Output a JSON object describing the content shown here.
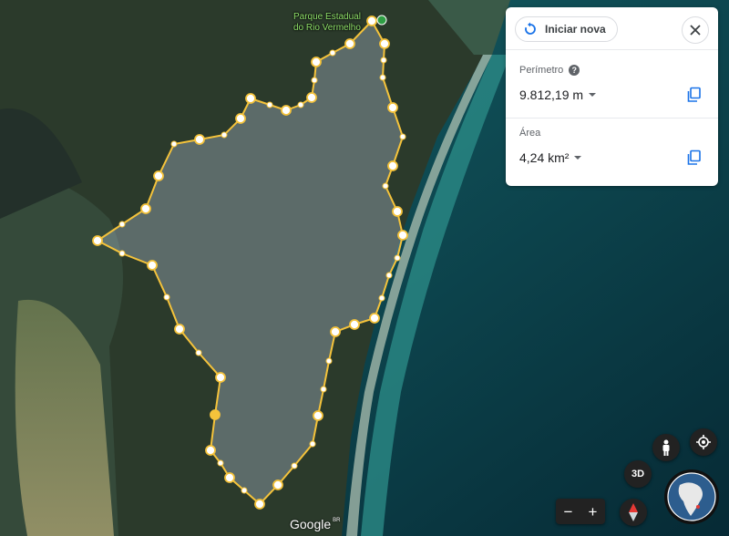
{
  "map": {
    "place_label_line1": "Parque Estadual",
    "place_label_line2": "do Rio Vermelho",
    "logo_text": "Google",
    "logo_region": "BR",
    "route_color": "#f5c33b",
    "water_color": "#0e3a40"
  },
  "panel": {
    "restart_label": "Iniciar nova",
    "perimeter_label": "Perímetro",
    "perimeter_value": "9.812,19 m",
    "area_label": "Área",
    "area_value": "4,24 km²"
  },
  "controls": {
    "three_d_label": "3D",
    "zoom_out_label": "−",
    "zoom_in_label": "+",
    "help_glyph": "?"
  },
  "icons": [
    "restart-icon",
    "close-icon",
    "help-icon",
    "copy-icon",
    "pegman-icon",
    "my-location-icon",
    "compass-icon",
    "globe-icon"
  ]
}
